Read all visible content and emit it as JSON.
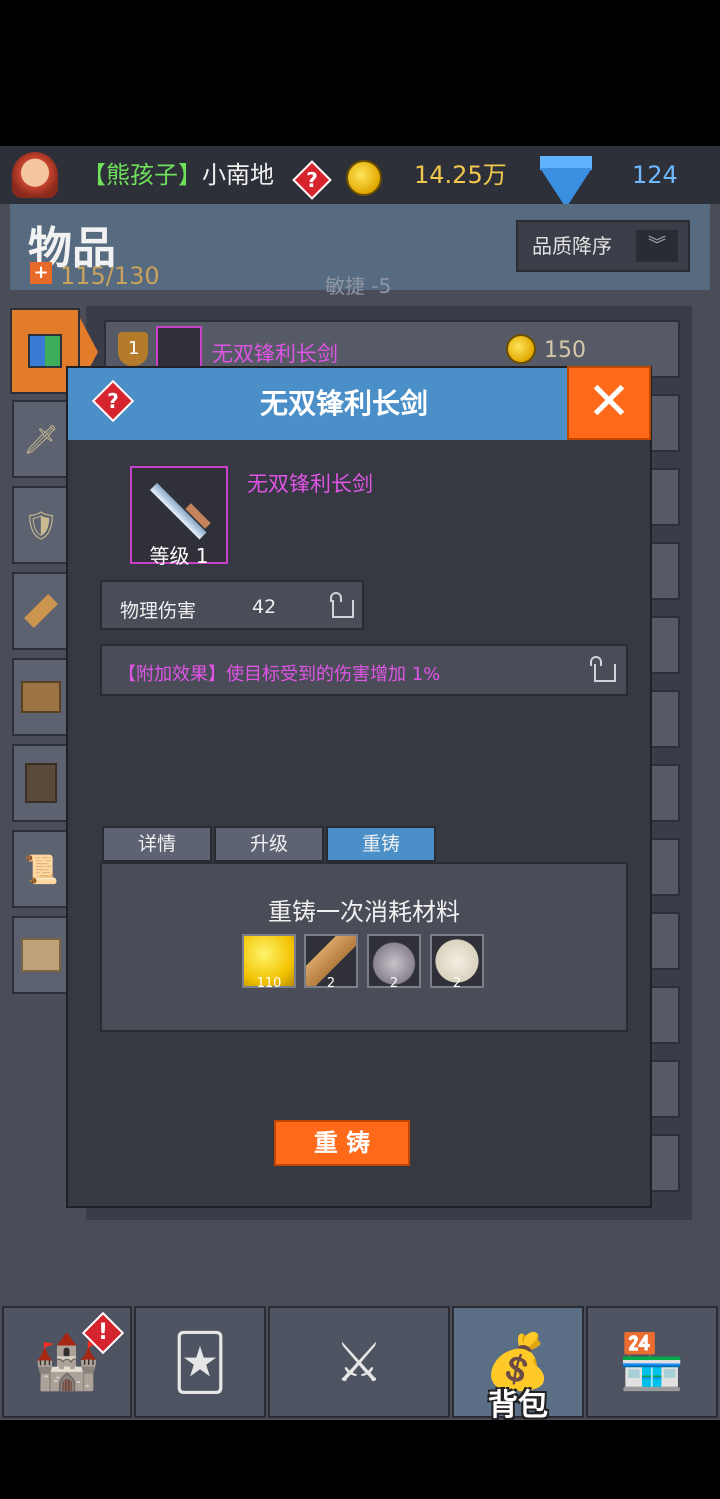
{
  "topbar": {
    "title_tag": "【熊孩子】",
    "player_name": "小南地",
    "gold": "14.25万",
    "gems": "124"
  },
  "header": {
    "title": "物品",
    "capacity": "115/130",
    "sort_label": "品质降序",
    "agility": "敏捷 -5"
  },
  "list": {
    "first_item": {
      "level": "1",
      "name": "无双锋利长剑",
      "price": "150"
    }
  },
  "modal": {
    "title": "无双锋利长剑",
    "item_name": "无双锋利长剑",
    "level_label": "等级 1",
    "stat_label": "物理伤害",
    "stat_value": "42",
    "effect_text": "【附加效果】使目标受到的伤害增加 1%",
    "tabs": [
      {
        "label": "详情"
      },
      {
        "label": "升级"
      },
      {
        "label": "重铸"
      }
    ],
    "materials_title": "重铸一次消耗材料",
    "materials": [
      {
        "icon": "gold-coin-icon",
        "count": "110"
      },
      {
        "icon": "wood-log-icon",
        "count": "2"
      },
      {
        "icon": "ore-icon",
        "count": "2"
      },
      {
        "icon": "cloth-icon",
        "count": "2"
      }
    ],
    "reforge_button": "重 铸"
  },
  "nav": {
    "bag_label": "背包"
  },
  "colors": {
    "accent_orange": "#ff6a1a",
    "header_blue": "#4b8fc9",
    "epic_purple": "#e055e6"
  }
}
